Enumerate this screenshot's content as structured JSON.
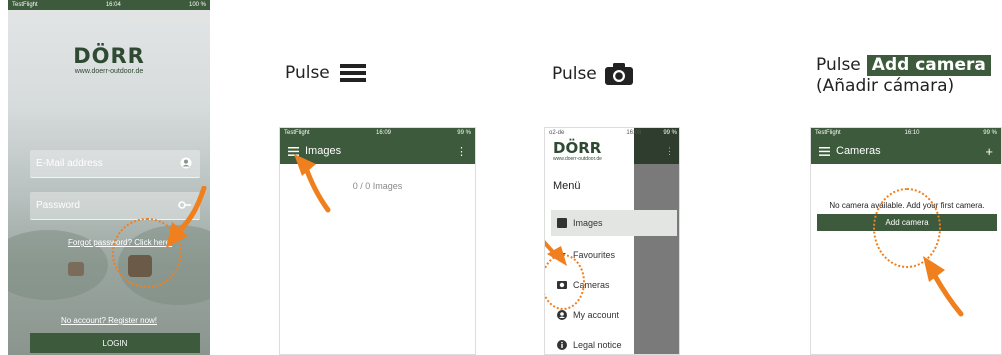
{
  "captions": {
    "step2_pulse": "Pulse",
    "step3_pulse": "Pulse",
    "step4_pulse": "Pulse",
    "step4_button": "Add camera",
    "step4_translation": "(Añadir cámara)"
  },
  "screen1": {
    "status": {
      "carrier": "TestFlight",
      "time": "16:04",
      "battery": "100 %"
    },
    "logo": "DÖRR",
    "website": "www.doerr-outdoor.de",
    "email_placeholder": "E-Mail address",
    "password_placeholder": "Password",
    "forgot": "Forgot password? Click here!",
    "register": "No account? Register now!",
    "login": "LOGIN"
  },
  "screen2": {
    "status": {
      "carrier": "TestFlight",
      "time": "16:09",
      "battery": "99 %"
    },
    "title": "Images",
    "count": "0 / 0 Images"
  },
  "screen3": {
    "status": {
      "carrier": "o2-de",
      "time": "16:08",
      "battery": "99 %"
    },
    "logo": "DÖRR",
    "website": "www.doerr-outdoor.de",
    "menu_title": "Menü",
    "items": [
      {
        "label": "Images",
        "icon": "image-icon",
        "active": true
      },
      {
        "label": "Favourites",
        "icon": "star-icon",
        "active": false
      },
      {
        "label": "Cameras",
        "icon": "camera-icon",
        "active": false
      },
      {
        "label": "My account",
        "icon": "account-icon",
        "active": false
      },
      {
        "label": "Legal notice",
        "icon": "info-icon",
        "active": false
      }
    ]
  },
  "screen4": {
    "status": {
      "carrier": "TestFlight",
      "time": "16:10",
      "battery": "99 %"
    },
    "title": "Cameras",
    "empty_message": "No camera available. Add your first camera.",
    "add_button": "Add camera"
  },
  "colors": {
    "brand_green": "#3d5a3c",
    "accent_orange": "#f07f1e"
  }
}
